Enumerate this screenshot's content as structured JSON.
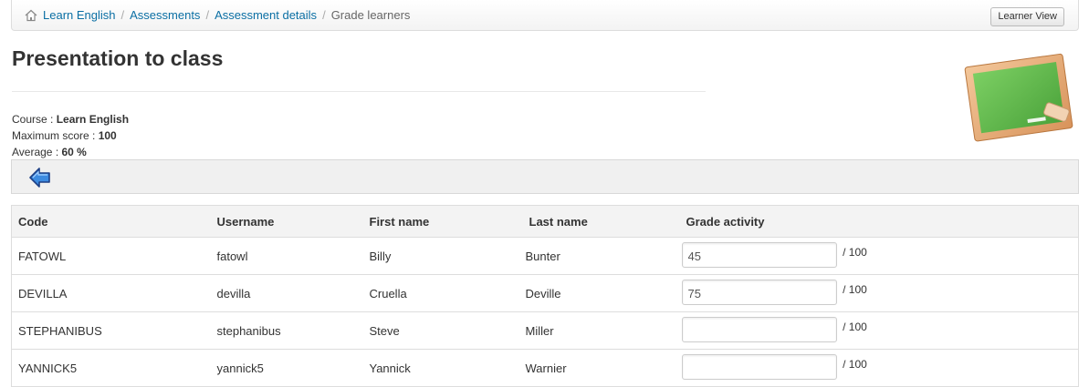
{
  "breadcrumb": {
    "items": [
      {
        "label": "Learn English"
      },
      {
        "label": "Assessments"
      },
      {
        "label": "Assessment details"
      }
    ],
    "current": "Grade learners",
    "separator": "/"
  },
  "header": {
    "learner_view_label": "Learner View",
    "title": "Presentation to class"
  },
  "info": {
    "course_label": "Course : ",
    "course_value": "Learn English",
    "max_label": "Maximum score : ",
    "max_value": "100",
    "avg_label": "Average : ",
    "avg_value": "60 %"
  },
  "table": {
    "headers": {
      "code": "Code",
      "username": "Username",
      "first_name": "First name",
      "last_name": "Last name",
      "grade": "Grade activity"
    },
    "rows": [
      {
        "code": "FATOWL",
        "username": "fatowl",
        "first_name": "Billy",
        "last_name": "Bunter",
        "grade": "45",
        "max": "/ 100"
      },
      {
        "code": "DEVILLA",
        "username": "devilla",
        "first_name": "Cruella",
        "last_name": "Deville",
        "grade": "75",
        "max": "/ 100"
      },
      {
        "code": "STEPHANIBUS",
        "username": "stephanibus",
        "first_name": "Steve",
        "last_name": "Miller",
        "grade": "",
        "max": "/ 100"
      },
      {
        "code": "YANNICK5",
        "username": "yannick5",
        "first_name": "Yannick",
        "last_name": "Warnier",
        "grade": "",
        "max": "/ 100"
      }
    ]
  },
  "icons": {
    "home": "home-icon",
    "back": "back-arrow-icon",
    "board": "chalkboard-icon"
  },
  "colors": {
    "link": "#0b6fa4",
    "board_green": "#5fb548",
    "arrow_blue": "#2f7fd8"
  }
}
